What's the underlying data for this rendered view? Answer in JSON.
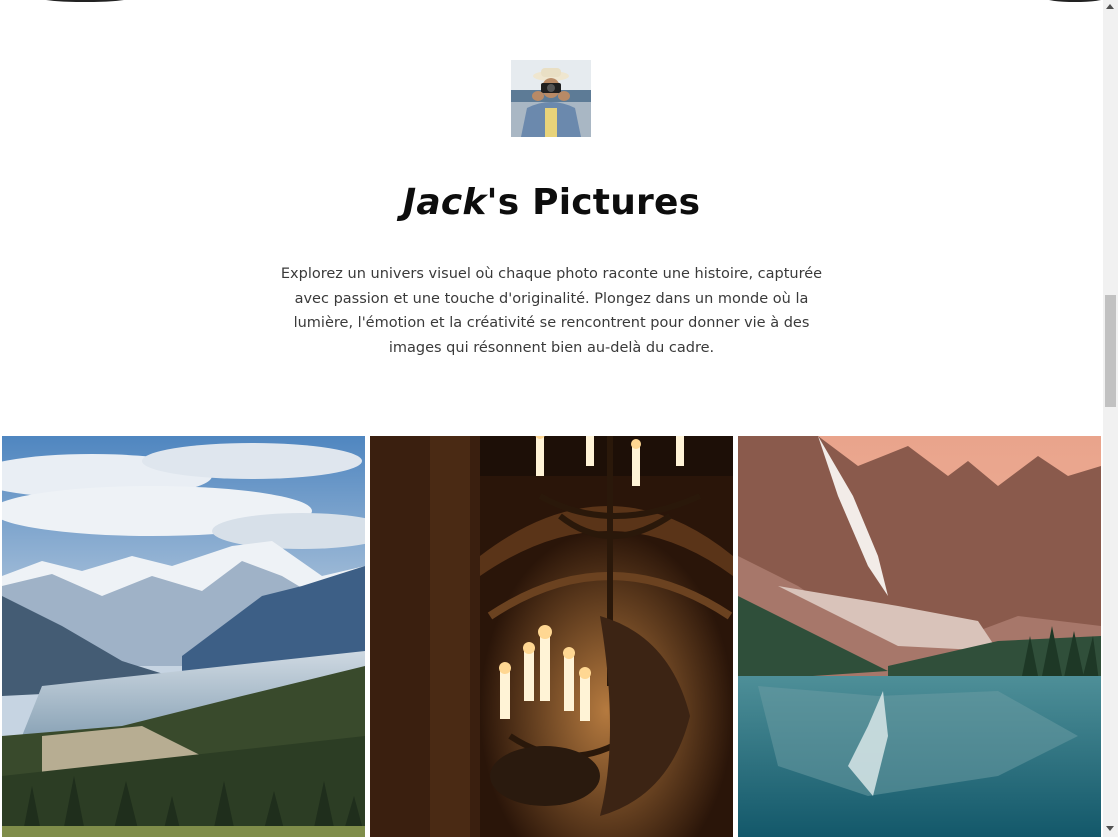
{
  "profile": {
    "avatar_icon": "photographer-avatar",
    "title_name": "Jack",
    "title_suffix": "'s Pictures",
    "description": "Explorez un univers visuel où chaque photo raconte une histoire, capturée avec passion et une touche d'originalité. Plongez dans un monde où la lumière, l'émotion et la créativité se rencontrent pour donner vie à des images qui résonnent bien au-delà du cadre."
  },
  "gallery": {
    "photos": [
      {
        "subject": "snowy-mountain-valley"
      },
      {
        "subject": "chandelier-interior"
      },
      {
        "subject": "mountain-lake-reflection"
      }
    ]
  },
  "scrollbar": {
    "position_fraction": 0.36
  }
}
